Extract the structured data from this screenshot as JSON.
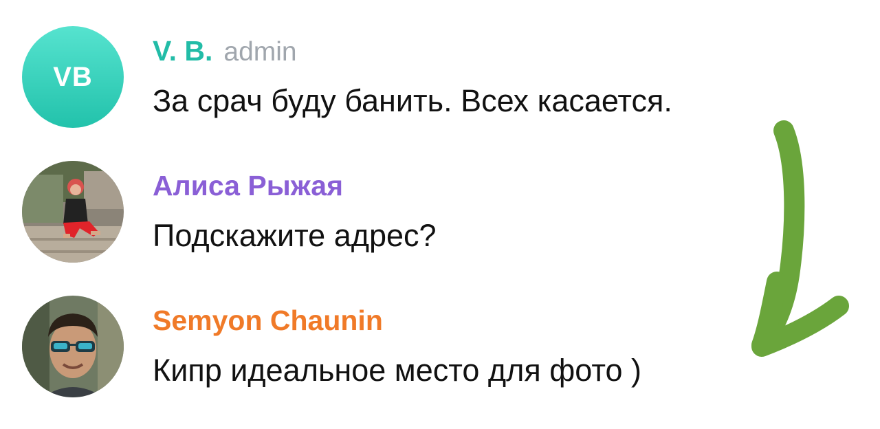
{
  "messages": [
    {
      "avatar_initials": "VB",
      "avatar_type": "initials",
      "sender": "V. B.",
      "sender_color": "#22bca7",
      "role": "admin",
      "text": "За срач буду банить. Всех касается."
    },
    {
      "avatar_type": "photo",
      "sender": "Алиса Рыжая",
      "sender_color": "#8a5fd6",
      "text": "Подскажите адрес?"
    },
    {
      "avatar_type": "photo",
      "sender": "Semyon Chaunin",
      "sender_color": "#f07a28",
      "text": "Кипр идеальное место для фото )"
    }
  ],
  "annotation": {
    "icon": "hand-drawn-arrow-icon",
    "color": "#6aa53b"
  }
}
